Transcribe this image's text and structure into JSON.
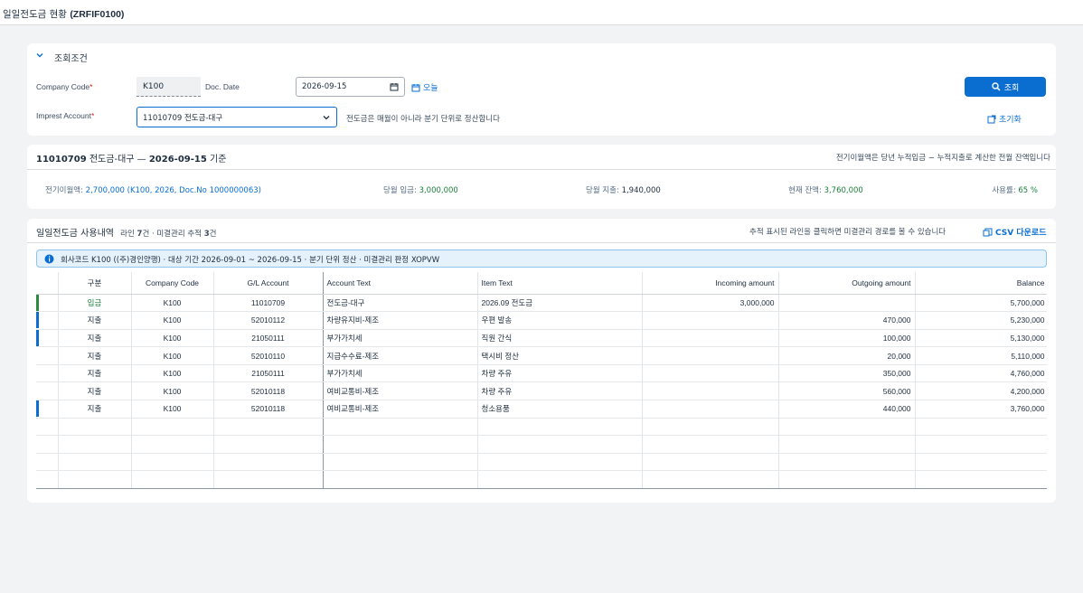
{
  "app": {
    "title_ko": "일일전도금 현황",
    "title_code": "(ZRFIF0100)"
  },
  "filter": {
    "section_title": "조회조건",
    "company_code_label": "Company Code",
    "company_code_value": "K100",
    "doc_date_label": "Doc. Date",
    "doc_date_value": "2026-09-15",
    "today_label": "오늘",
    "imprest_account_label": "Imprest Account",
    "imprest_account_value": "11010709 전도금-대구",
    "hint": "전도금은 매월이 아니라 분기 단위로 정산합니다",
    "search_label": "조회",
    "reset_label": "초기화"
  },
  "summary": {
    "account": "11010709",
    "account_name": "전도금-대구 —",
    "date": "2026-09-15",
    "date_suffix": "기준",
    "note": "전기이월액은 당년 누적입금 − 누적지출로 계산한 전월 잔액입니다",
    "carryover_label": "전기이월액:",
    "carryover_value": "2,700,000 (K100, 2026, Doc.No 1000000063)",
    "month_in_label": "당월 입금:",
    "month_in_value": "3,000,000",
    "month_out_label": "당월 지출:",
    "month_out_value": "1,940,000",
    "balance_label": "현재 잔액:",
    "balance_value": "3,760,000",
    "usage_label": "사용률:",
    "usage_value": "65 %"
  },
  "list": {
    "title": "일일전도금 사용내역",
    "sub_prefix": "라인",
    "line_count": "7",
    "sub_mid": "건 · 미결관리 추적",
    "track_count": "3",
    "sub_suffix": "건",
    "hint": "추적 표시된 라인을 클릭하면 미결관리 경로를 볼 수 있습니다",
    "csv_label": "CSV 다운로드",
    "info": "회사코드 K100 ((주)경인양행) · 대상 기간 2026-09-01 ~ 2026-09-15 · 분기 단위 정산 · 미결관리 판정 XOPVW",
    "columns": {
      "type": "구분",
      "company": "Company Code",
      "gl": "G/L Account",
      "acct_text": "Account Text",
      "item_text": "Item Text",
      "incoming": "Incoming amount",
      "outgoing": "Outgoing amount",
      "balance": "Balance"
    },
    "rows": [
      {
        "mark": "green",
        "type": "입금",
        "company": "K100",
        "gl": "11010709",
        "acct_text": "전도금-대구",
        "item_text": "2026.09 전도금",
        "incoming": "3,000,000",
        "outgoing": "",
        "balance": "5,700,000"
      },
      {
        "mark": "blue",
        "type": "지출",
        "company": "K100",
        "gl": "52010112",
        "acct_text": "차량유지비-제조",
        "item_text": "우편 발송",
        "incoming": "",
        "outgoing": "470,000",
        "balance": "5,230,000"
      },
      {
        "mark": "blue",
        "type": "지출",
        "company": "K100",
        "gl": "21050111",
        "acct_text": "부가가치세",
        "item_text": "직원 간식",
        "incoming": "",
        "outgoing": "100,000",
        "balance": "5,130,000"
      },
      {
        "mark": "",
        "type": "지출",
        "company": "K100",
        "gl": "52010110",
        "acct_text": "지급수수료-제조",
        "item_text": "택시비 정산",
        "incoming": "",
        "outgoing": "20,000",
        "balance": "5,110,000"
      },
      {
        "mark": "",
        "type": "지출",
        "company": "K100",
        "gl": "21050111",
        "acct_text": "부가가치세",
        "item_text": "차량 주유",
        "incoming": "",
        "outgoing": "350,000",
        "balance": "4,760,000"
      },
      {
        "mark": "",
        "type": "지출",
        "company": "K100",
        "gl": "52010118",
        "acct_text": "여비교통비-제조",
        "item_text": "차량 주유",
        "incoming": "",
        "outgoing": "560,000",
        "balance": "4,200,000"
      },
      {
        "mark": "blue",
        "type": "지출",
        "company": "K100",
        "gl": "52010118",
        "acct_text": "여비교통비-제조",
        "item_text": "청소용품",
        "incoming": "",
        "outgoing": "440,000",
        "balance": "3,760,000"
      }
    ]
  },
  "colors": {
    "accent": "#0a6ed1",
    "incoming_mark": "#2e8b3e",
    "tracked_mark": "#0a6ed1",
    "positive_text": "#1a7f3c"
  }
}
